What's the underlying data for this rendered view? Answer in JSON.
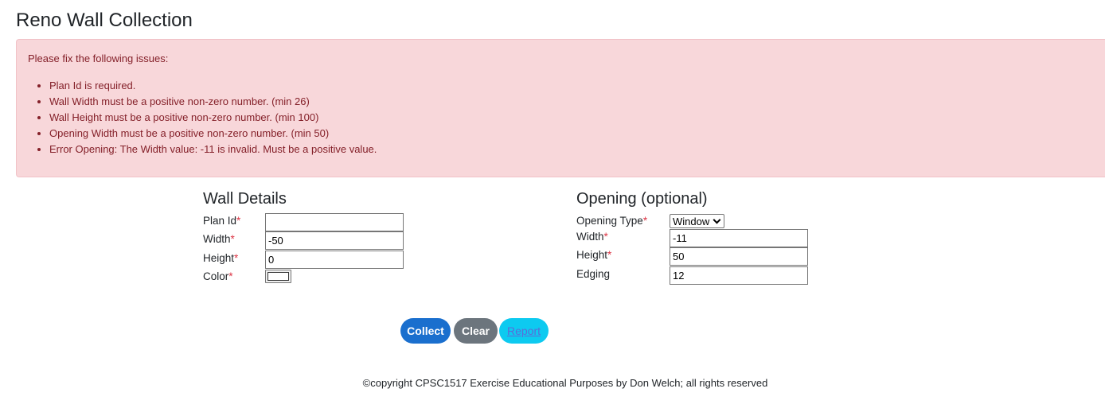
{
  "page": {
    "title": "Reno Wall Collection"
  },
  "errors": {
    "heading": "Please fix the following issues:",
    "items": [
      "Plan Id is required.",
      "Wall Width must be a positive non-zero number. (min 26)",
      "Wall Height must be a positive non-zero number. (min 100)",
      "Opening Width must be a positive non-zero number. (min 50)",
      "Error Opening: The Width value: -11 is invalid. Must be a positive value."
    ],
    "colors": {
      "background": "#f8d7da",
      "text": "#842029"
    }
  },
  "wall": {
    "title": "Wall Details",
    "plan_id_label": "Plan Id",
    "plan_id_value": "",
    "width_label": "Width",
    "width_value": "-50",
    "height_label": "Height",
    "height_value": "0",
    "color_label": "Color",
    "color_value": "#ffffff"
  },
  "opening": {
    "title": "Opening (optional)",
    "type_label": "Opening Type",
    "type_selected": "Window",
    "width_label": "Width",
    "width_value": "-11",
    "height_label": "Height",
    "height_value": "50",
    "edging_label": "Edging",
    "edging_value": "12"
  },
  "required_marker": "*",
  "buttons": {
    "collect": "Collect",
    "clear": "Clear",
    "report": "Report"
  },
  "footer": {
    "text": "©copyright CPSC1517 Exercise Educational Purposes by Don Welch; all rights reserved"
  },
  "icons": {
    "select_arrow": "chevron-down-icon"
  }
}
